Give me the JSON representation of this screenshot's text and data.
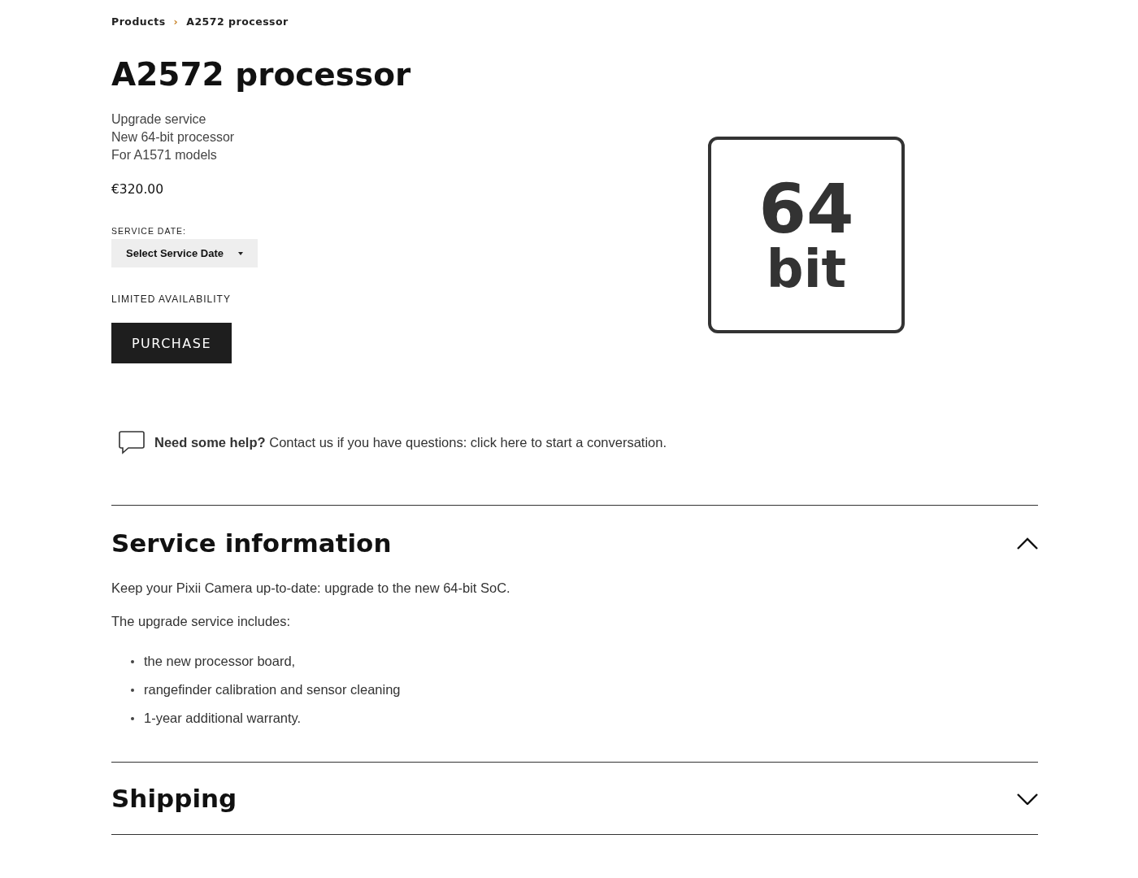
{
  "breadcrumb": [
    {
      "label": "Products"
    },
    {
      "label": "A2572 processor"
    }
  ],
  "breadcrumb_separator": "›",
  "product": {
    "title": "A2572 processor",
    "details": [
      "Upgrade service",
      "New 64-bit processor",
      "For A1571 models"
    ],
    "price": "€320.00",
    "service_date": {
      "label": "SERVICE DATE:",
      "value": "Select Service Date"
    },
    "availability": "LIMITED AVAILABILITY",
    "purchase_button": "PURCHASE",
    "image_text": [
      "64",
      "bit"
    ]
  },
  "help": "**Need some help?** Contact us if you have questions: click here to start a conversation.",
  "sections": [
    {
      "title": "Service information",
      "expanded": true,
      "paragraphs": [
        "Keep your Pixii Camera up-to-date: upgrade to the new 64-bit SoC.",
        "The upgrade service includes:"
      ],
      "bullets": [
        "the new processor board,",
        "rangefinder calibration and sensor cleaning",
        "1-year additional warranty."
      ]
    },
    {
      "title": "Shipping",
      "expanded": false
    }
  ]
}
